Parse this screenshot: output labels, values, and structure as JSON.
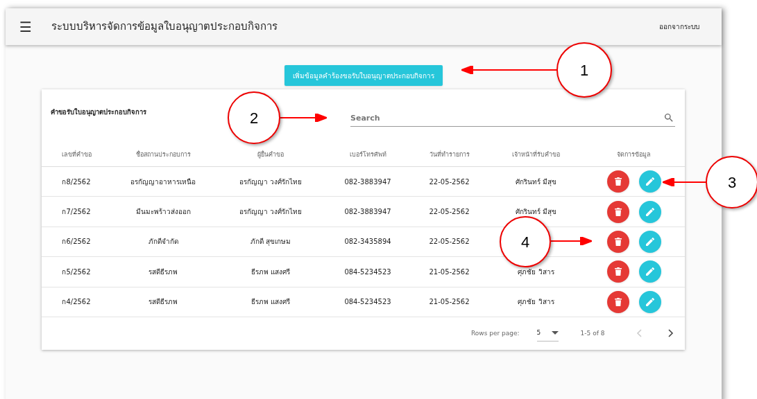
{
  "app_bar": {
    "menu_icon": "☰",
    "title": "ระบบบริหารจัดการข้อมูลใบอนุญาตประกอบกิจการ",
    "logout": "ออกจากระบบ"
  },
  "add_button": "เพิ่มข้อมูลคำร้องขอรับใบอนุญาตประกอบกิจการ",
  "card": {
    "title": "คำขอรับใบอนุญาตประกอบกิจการ",
    "search": {
      "placeholder": "Search"
    },
    "table": {
      "columns": [
        "เลขที่คำขอ",
        "ชื่อสถานประกอบการ",
        "ผู้ยื่นคำขอ",
        "เบอร์โทรศัพท์",
        "วันที่ทำรายการ",
        "เจ้าหน้าที่รับคำขอ",
        "จัดการข้อมูล"
      ],
      "rows": [
        {
          "no": "ก8/2562",
          "business": "อรกัญญาอาหารเหนือ",
          "applicant": "อรกัญญา วงศ์รักไทย",
          "phone": "082-3883947",
          "date": "22-05-2562",
          "officer": "ศักรินทร์ มีสุข"
        },
        {
          "no": "ก7/2562",
          "business": "มีนมะพร้าวส่งออก",
          "applicant": "อรกัญญา วงศ์รักไทย",
          "phone": "082-3883947",
          "date": "22-05-2562",
          "officer": "ศักรินทร์ มีสุข"
        },
        {
          "no": "ก6/2562",
          "business": "ภักดีจำกัด",
          "applicant": "ภักดี สุขเกษม",
          "phone": "082-3435894",
          "date": "22-05-2562"
        },
        {
          "no": "ก5/2562",
          "business": "รสดีธีรภพ",
          "applicant": "ธีรภพ แสงศรี",
          "phone": "084-5234523",
          "date": "21-05-2562",
          "officer": "ศุภชัย วิสาร"
        },
        {
          "no": "ก4/2562",
          "business": "รสดีธีรภพ",
          "applicant": "ธีรภพ แสงศรี",
          "phone": "084-5234523",
          "date": "21-05-2562",
          "officer": "ศุภชัย วิสาร"
        }
      ]
    },
    "pagination": {
      "rows_per_page_label": "Rows per page:",
      "rows_per_page": "5",
      "range": "1-5 of 8"
    }
  },
  "callouts": [
    {
      "number": "1"
    },
    {
      "number": "2"
    },
    {
      "number": "3"
    },
    {
      "number": "4"
    }
  ]
}
